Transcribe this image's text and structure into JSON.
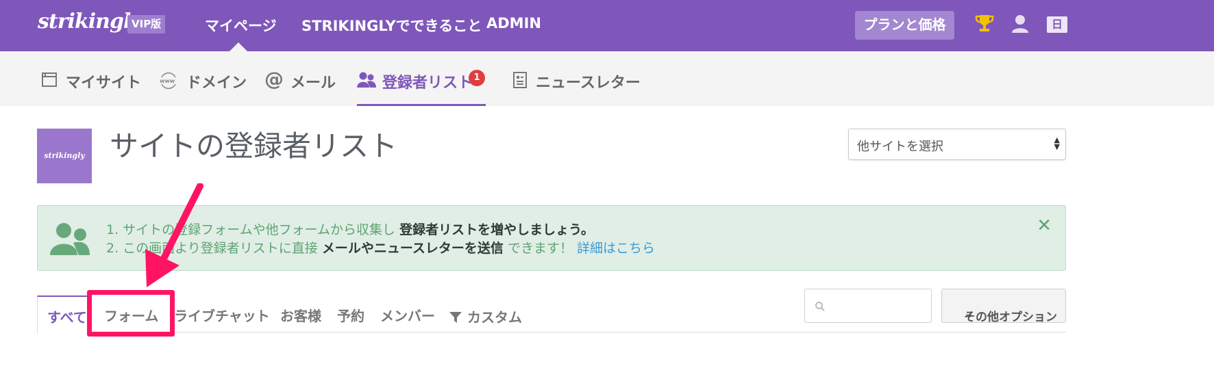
{
  "topbar": {
    "logo": "strikingly",
    "vip_badge": "VIP版",
    "nav": [
      "マイページ",
      "STRIKINGLYでできること",
      "ADMIN"
    ],
    "plan_button": "プランと価格",
    "icons": [
      "trophy-icon",
      "user-icon"
    ],
    "lang": "日",
    "color": "#7f57ba"
  },
  "subnav": {
    "items": [
      {
        "label": "マイサイト",
        "icon": "calendar-window-icon"
      },
      {
        "label": "ドメイン",
        "icon": "www-globe-icon"
      },
      {
        "label": "メール",
        "icon": "at-icon"
      },
      {
        "label": "登録者リスト",
        "icon": "users-icon",
        "badge": "1",
        "active": true
      },
      {
        "label": "ニュースレター",
        "icon": "newsletter-icon"
      }
    ]
  },
  "page": {
    "thumb_text": "strikingly",
    "title": "サイトの登録者リスト",
    "site_select": "他サイトを選択"
  },
  "info": {
    "line1_pre": "1. サイトの登録フォームや他フォームから収集し",
    "line1_bold": "登録者リストを増やしましょう。",
    "line2_pre": "2. この画面より登録者リストに直接",
    "line2_bold": "メールやニュースレターを送信",
    "line2_post": "できます！",
    "line2_link": "詳細はこちら"
  },
  "tabs": [
    "すべて",
    "フォーム",
    "ライブチャット",
    "お客様",
    "予約",
    "メンバー",
    "カスタム"
  ],
  "toolbar": {
    "search_placeholder": "",
    "options": "その他オプション"
  },
  "annotation_color": "#ff1464"
}
